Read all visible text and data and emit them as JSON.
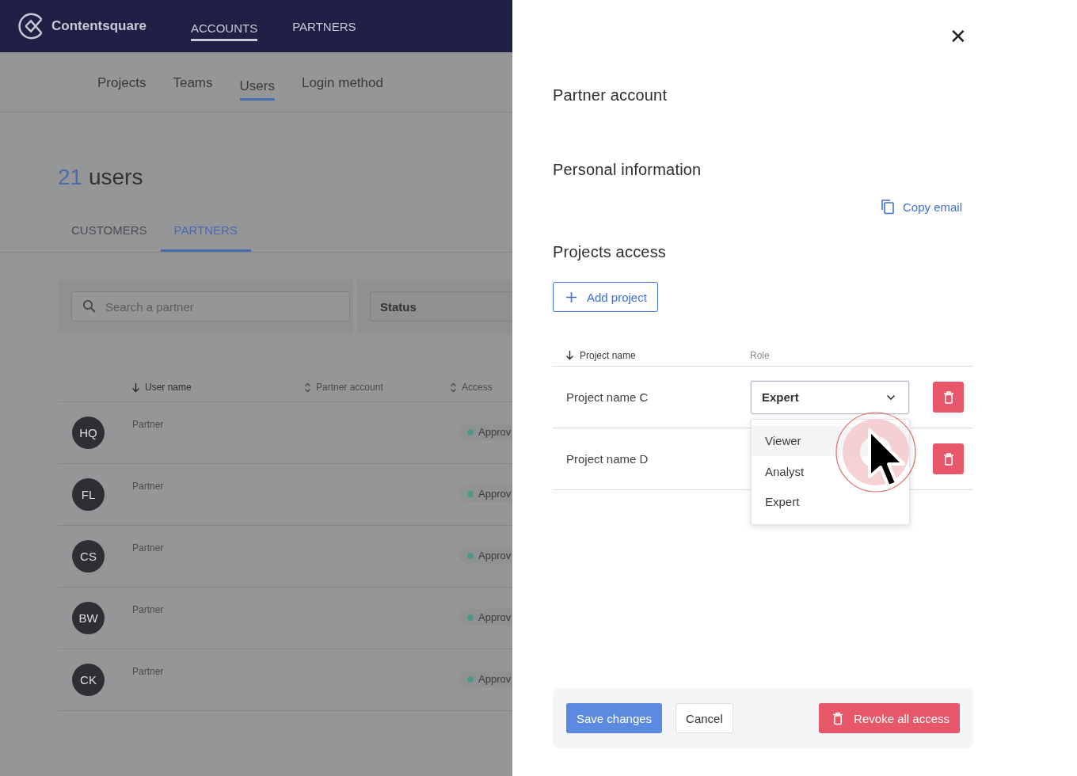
{
  "top_nav": {
    "logo": "Contentsquare",
    "items": [
      {
        "label": "ACCOUNTS",
        "selected": true
      },
      {
        "label": "PARTNERS",
        "selected": false
      }
    ]
  },
  "sub_nav": [
    {
      "label": "Projects",
      "selected": false
    },
    {
      "label": "Teams",
      "selected": false
    },
    {
      "label": "Users",
      "selected": true
    },
    {
      "label": "Login method",
      "selected": false
    }
  ],
  "heading": {
    "count": "21",
    "label": "users"
  },
  "user_tabs": [
    {
      "label": "CUSTOMERS",
      "selected": false
    },
    {
      "label": "PARTNERS",
      "selected": true
    }
  ],
  "search": {
    "placeholder": "Search a partner"
  },
  "status_filter": {
    "label": "Status"
  },
  "users_table": {
    "columns": [
      {
        "label": "User name",
        "kind": "sorted"
      },
      {
        "label": "Partner account",
        "kind": "sortable"
      },
      {
        "label": "Access",
        "kind": "sortable"
      }
    ],
    "rows": [
      {
        "initials": "HQ",
        "type": "Partner",
        "status": "Approv"
      },
      {
        "initials": "FL",
        "type": "Partner",
        "status": "Approv"
      },
      {
        "initials": "CS",
        "type": "Partner",
        "status": "Approv"
      },
      {
        "initials": "BW",
        "type": "Partner",
        "status": "Approv"
      },
      {
        "initials": "CK",
        "type": "Partner",
        "status": "Approv"
      }
    ]
  },
  "drawer": {
    "close": "✕",
    "partner_title": "Partner account",
    "personal_title": "Personal information",
    "copy_email": "Copy email",
    "projects_title": "Projects access",
    "add_project": "Add project",
    "columns": [
      {
        "label": "Project name",
        "kind": "sorted"
      },
      {
        "label": "Role",
        "kind": "plain"
      }
    ],
    "projects": [
      {
        "name": "Project name C",
        "role": "Expert",
        "expanded": true
      },
      {
        "name": "Project name D"
      }
    ],
    "role_options": [
      {
        "label": "Viewer",
        "selected": true
      },
      {
        "label": "Analyst",
        "selected": false
      },
      {
        "label": "Expert",
        "selected": false
      }
    ],
    "save": "Save changes",
    "cancel": "Cancel",
    "revoke": "Revoke all access"
  }
}
